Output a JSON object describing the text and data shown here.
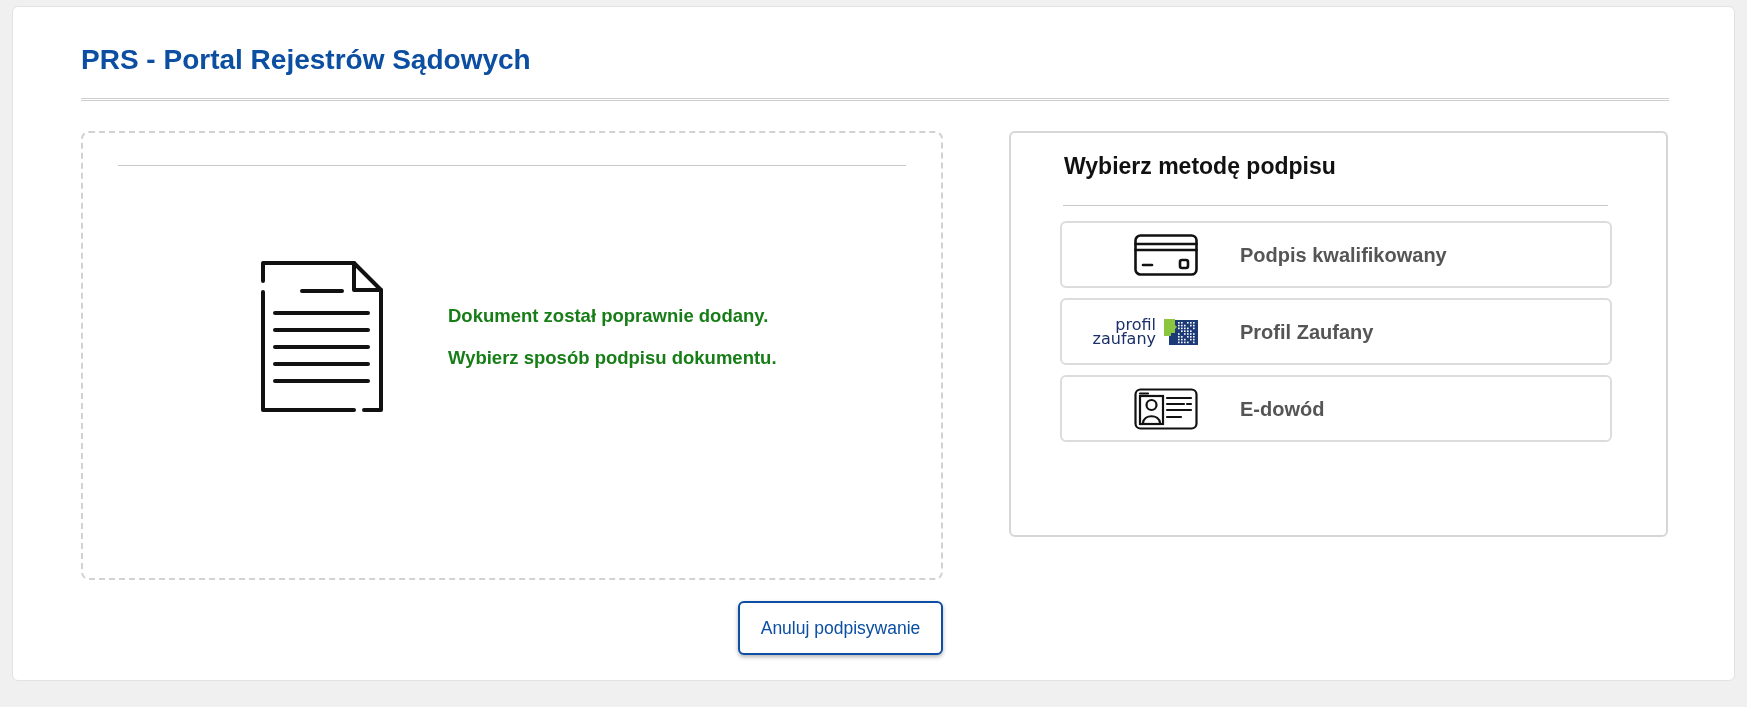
{
  "header": {
    "title": "PRS - Portal Rejestrów Sądowych"
  },
  "document_panel": {
    "messages": [
      "Dokument został poprawnie dodany.",
      "Wybierz sposób podpisu dokumentu."
    ]
  },
  "signature_panel": {
    "title": "Wybierz metodę podpisu",
    "methods": [
      {
        "kind": "card",
        "label": "Podpis kwalifikowany"
      },
      {
        "kind": "logo",
        "label": "Profil Zaufany",
        "logo_text": "profil zaufany"
      },
      {
        "kind": "id",
        "label": "E-dowód"
      }
    ]
  },
  "cancel_button": {
    "label": "Anuluj podpisywanie"
  }
}
